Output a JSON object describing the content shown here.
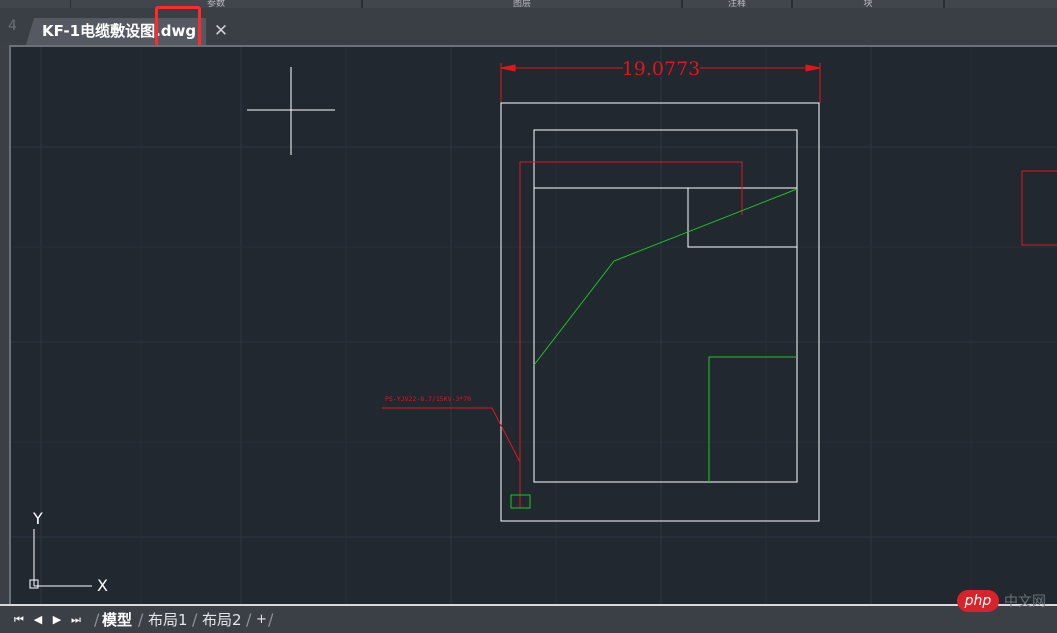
{
  "ribbon": {
    "segments": [
      "参数",
      "图层",
      "注释",
      "块",
      ""
    ]
  },
  "tab": {
    "title": "KF-1电缆敷设图.dwg",
    "close_glyph": "✕",
    "stub_glyph": "4"
  },
  "drawing": {
    "dimension_text": "19.0773",
    "cable_label": "PS-YJV22-8.7/15KV-3*70",
    "ucs_x": "X",
    "ucs_y": "Y",
    "colors": {
      "background": "#212830",
      "white": "#ffffff",
      "red": "#e0161b",
      "green": "#19c81f",
      "grid": "#2d3640"
    }
  },
  "layout": {
    "nav": [
      "⏮",
      "◀",
      "▶",
      "⏭"
    ],
    "tabs": [
      "模型",
      "布局1",
      "布局2",
      "+"
    ]
  },
  "watermark": {
    "logo": "php",
    "text": "中文网"
  }
}
